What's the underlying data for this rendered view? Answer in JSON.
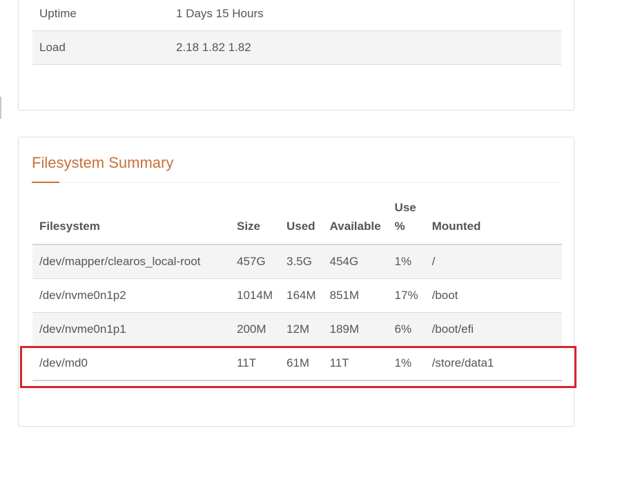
{
  "system_info": {
    "rows": [
      {
        "label": "Uptime",
        "value": "1 Days 15 Hours"
      },
      {
        "label": "Load",
        "value": "2.18 1.82 1.82"
      }
    ]
  },
  "filesystem_summary": {
    "title": "Filesystem Summary",
    "headers": {
      "filesystem": "Filesystem",
      "size": "Size",
      "used": "Used",
      "available": "Available",
      "use_pct_line1": "Use",
      "use_pct_line2": "%",
      "mounted": "Mounted"
    },
    "rows": [
      {
        "filesystem": "/dev/mapper/clearos_local-root",
        "size": "457G",
        "used": "3.5G",
        "available": "454G",
        "use_pct": "1%",
        "mounted": "/"
      },
      {
        "filesystem": "/dev/nvme0n1p2",
        "size": "1014M",
        "used": "164M",
        "available": "851M",
        "use_pct": "17%",
        "mounted": "/boot"
      },
      {
        "filesystem": "/dev/nvme0n1p1",
        "size": "200M",
        "used": "12M",
        "available": "189M",
        "use_pct": "6%",
        "mounted": "/boot/efi"
      },
      {
        "filesystem": "/dev/md0",
        "size": "11T",
        "used": "61M",
        "available": "11T",
        "use_pct": "1%",
        "mounted": "/store/data1"
      }
    ]
  },
  "colors": {
    "accent": "#c9703a",
    "highlight": "#d9242d",
    "row_shade": "#f4f4f4",
    "text": "#555555"
  }
}
